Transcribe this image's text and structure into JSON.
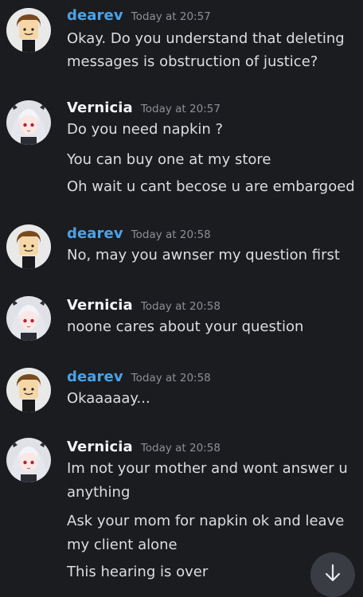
{
  "messages": [
    {
      "author": "dearev",
      "time": "Today at 20:57",
      "lines": [
        "Okay. Do you understand that deleting",
        "messages is obstruction of justice?"
      ]
    },
    {
      "author": "Vernicia",
      "time": "Today at 20:57",
      "lines": [
        "Do you need napkin ?",
        "You can buy one at my store",
        "Oh wait u cant becose u are embargoed"
      ]
    },
    {
      "author": "dearev",
      "time": "Today at 20:58",
      "lines": [
        "No, may you awnser my question first"
      ]
    },
    {
      "author": "Vernicia",
      "time": "Today at 20:58",
      "lines": [
        "noone cares about your question"
      ]
    },
    {
      "author": "dearev",
      "time": "Today at 20:58",
      "lines": [
        "Okaaaaay..."
      ]
    },
    {
      "author": "Vernicia",
      "time": "Today at 20:58",
      "lines": [
        "Im not your mother and wont answer u",
        "anything",
        "Ask your mom for napkin ok and leave",
        "my client alone",
        "This hearing is over"
      ]
    }
  ],
  "icons": {
    "avatar_dearev": "roblox-avatar-icon",
    "avatar_vernicia": "anime-girl-avatar-icon",
    "scroll_button": "arrow-down-icon"
  },
  "colors": {
    "background": "#1b1c20",
    "dearev_name": "#4aa3e8",
    "vernicia_name": "#f2f3f5",
    "timestamp": "#8d8f96",
    "message_text": "#dcdde0",
    "scroll_button": "#3a3c43"
  }
}
